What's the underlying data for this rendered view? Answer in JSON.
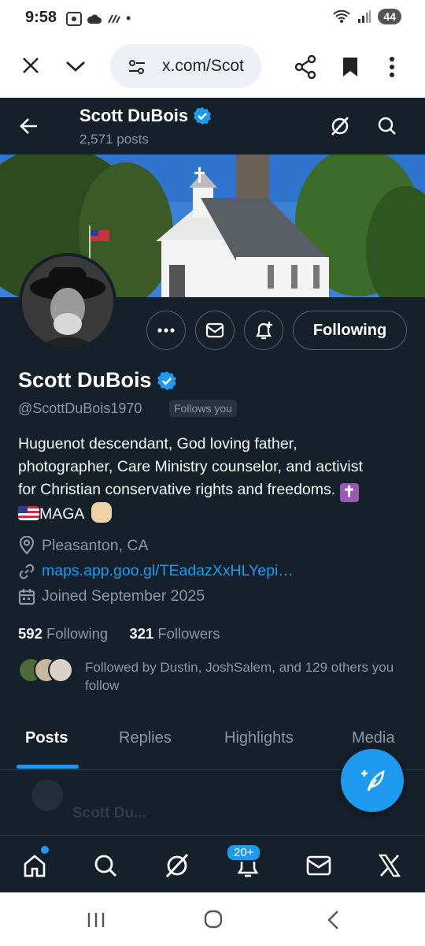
{
  "status_bar": {
    "time": "9:58",
    "battery": "44"
  },
  "browser": {
    "url": "x.com/Scot"
  },
  "header": {
    "name": "Scott DuBois",
    "posts_count": "2,571 posts"
  },
  "profile": {
    "name": "Scott DuBois",
    "handle": "@ScottDuBois1970",
    "follows_you": "Follows you",
    "follow_button": "Following",
    "bio_line1": "Huguenot descendant, God loving father,",
    "bio_line2": "photographer, Care Ministry counselor, and activist",
    "bio_line3": "for Christian conservative rights and freedoms.",
    "bio_line4": "MAGA",
    "location": "Pleasanton, CA",
    "link": "maps.app.goo.gl/TEadazXxHLYepi…",
    "joined": "Joined September 2025",
    "following_count": "592",
    "following_label": "Following",
    "followers_count": "321",
    "followers_label": "Followers",
    "followed_by": "Followed by Dustin, JoshSalem, and 129 others you follow"
  },
  "tabs": [
    "Posts",
    "Replies",
    "Highlights",
    "Media"
  ],
  "ghost_post": {
    "name": "Scott Du..."
  },
  "bottom_nav": {
    "notifications_badge": "20+"
  },
  "colors": {
    "background": "#15202b",
    "accent": "#1d9bf0",
    "muted": "#8b98a5"
  }
}
